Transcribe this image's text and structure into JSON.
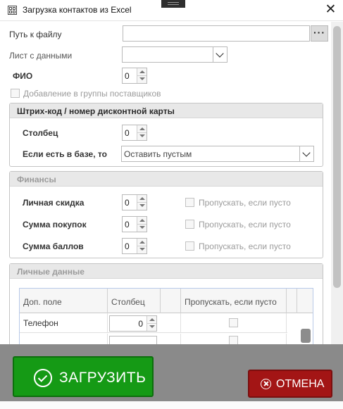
{
  "window": {
    "title": "Загрузка контактов из Excel",
    "close_glyph": "✕"
  },
  "file": {
    "path_label": "Путь к файлу",
    "path_value": "",
    "browse_label": "···"
  },
  "sheet": {
    "label": "Лист с данными",
    "value": ""
  },
  "fio": {
    "label": "ФИО",
    "value": "0"
  },
  "supplier_groups": {
    "label": "Добавление в группы поставщиков",
    "checked": false
  },
  "barcode_group": {
    "title": "Штрих-код / номер дисконтной карты",
    "column_label": "Столбец",
    "column_value": "0",
    "exists_label": "Если есть в базе, то",
    "exists_value": "Оставить пустым"
  },
  "finance_group": {
    "title": "Финансы",
    "rows": [
      {
        "label": "Личная скидка",
        "value": "0",
        "skip_label": "Пропускать, если пусто"
      },
      {
        "label": "Сумма покупок",
        "value": "0",
        "skip_label": "Пропускать, если пусто"
      },
      {
        "label": "Сумма баллов",
        "value": "0",
        "skip_label": "Пропускать, если пусто"
      }
    ]
  },
  "personal_group": {
    "title": "Личные данные",
    "columns": [
      "Доп. поле",
      "Столбец",
      "Пропускать, если пусто"
    ],
    "rows": [
      {
        "field": "Телефон",
        "column": "0"
      },
      {
        "field": "",
        "column": ""
      }
    ]
  },
  "footer": {
    "load_label": "ЗАГРУЗИТЬ",
    "cancel_label": "ОТМЕНА"
  },
  "colors": {
    "load_button": "#159a15",
    "cancel_button": "#a31515",
    "footer_bg": "#8a8a8a"
  }
}
